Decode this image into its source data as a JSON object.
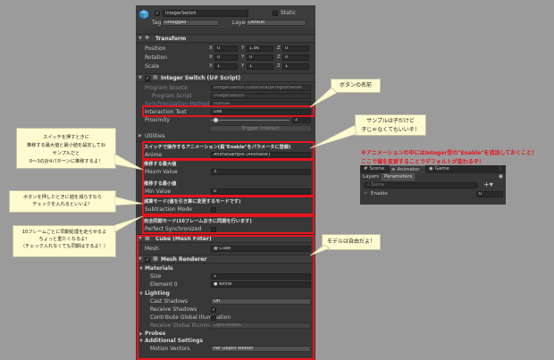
{
  "inspector": {
    "object_name": "IntegerSwitch",
    "static_label": "Static",
    "tag_label": "Tag",
    "tag_value": "Untagged",
    "layer_label": "Layer",
    "layer_value": "Default",
    "transform": {
      "title": "Transform",
      "rows": [
        {
          "label": "Position",
          "x": "0",
          "y": "1.86",
          "z": "0"
        },
        {
          "label": "Rotation",
          "x": "0",
          "y": "0",
          "z": "0"
        },
        {
          "label": "Scale",
          "x": "1",
          "y": "1",
          "z": "1"
        }
      ],
      "axes": [
        "X",
        "Y",
        "Z"
      ]
    },
    "script": {
      "title": "Integer Switch (U# Script)",
      "rows": [
        {
          "label": "Program Source",
          "value": "IntegerSwitch (UdonSharpProgramAsse"
        },
        {
          "label": "Program Script",
          "value": "IntegerSwitch"
        },
        {
          "label": "Synchronization Method",
          "value": "Manual"
        }
      ],
      "interaction_text_label": "Interaction Text",
      "interaction_text_value": "Use",
      "proximity_label": "Proximity",
      "proximity_value": "2",
      "trigger_button": "Trigger Interact",
      "utilities_label": "Utilities",
      "anim_header": "スイッチで操作するアニメーション(黒\"Enable\"をパラメータに登録)",
      "anime_label": "Anime",
      "anime_value": "AnimeSample (Animator)",
      "max_header": "推移する最大値",
      "max_label": "Maxm Value",
      "max_value": "3",
      "min_header": "推移する最小値",
      "min_label": "Min Value",
      "min_value": "0",
      "sub_header": "減算モード(値を引き算に変更するモードです)",
      "sub_label": "Subtraction Mode",
      "sync_header": "完全同期モード(10フレームおきに同期を行います)",
      "sync_label": "Perfect Synchronized"
    },
    "mesh_filter": {
      "title": "Cube (Mesh Filter)",
      "mesh_label": "Mesh",
      "mesh_value": "Cube"
    },
    "mesh_renderer": {
      "title": "Mesh Renderer",
      "materials_label": "Materials",
      "size_label": "Size",
      "size_value": "1",
      "element_label": "Element 0",
      "element_value": "White",
      "lighting_label": "Lighting",
      "cast_label": "Cast Shadows",
      "cast_value": "On",
      "receive_label": "Receive Shadows",
      "contribute_label": "Contribute Global Illumination",
      "receive_gi_label": "Receive Global Illumination",
      "receive_gi_value": "Light Probes",
      "probes_label": "Probes",
      "additional_label": "Additional Settings",
      "motion_label": "Motion Vectors",
      "motion_value": "Per Object Motion"
    }
  },
  "annotations": {
    "button_name": "ボタンの名前",
    "sample_line1": "サンプルは子だけど",
    "sample_line2": "子じゃなくてもいいぞ！",
    "switch_line1": "スイッチを押すときに",
    "switch_line2": "推移する最大値と最小値を設定してね",
    "switch_line3": "サンプルだと",
    "switch_line4": "0～3の計4パターンに推移するよ！",
    "sub_line1": "ボタンを押したときに値を減らすなら",
    "sub_line2": "チェックを入れるといいよ！",
    "sync_line1": "10フレームごとに同期処理を走らせるよ",
    "sync_line2": "ちょっと重たくなるよ！",
    "sync_line3": "（チェック入れなくても同期はするよ！）",
    "model_note": "モデルは自由だよ！",
    "red_note1": "※アニメーションの中にはInteger型の\"Enable\"を追加しておくこと！",
    "red_note2": "ここで値を変更することでデフォルトが変わるぞ！"
  },
  "animator_panel": {
    "tabs": [
      "Scene",
      "Animator",
      "Game"
    ],
    "subtabs": [
      "Layers",
      "Parameters"
    ],
    "search_placeholder": "Name",
    "param_name": "Enable",
    "param_value": "0"
  },
  "colors": {
    "highlight_red": "#e8141e",
    "note_bg": "#fffbd0",
    "panel_bg": "#383838",
    "page_bg": "#9b9b9b"
  }
}
